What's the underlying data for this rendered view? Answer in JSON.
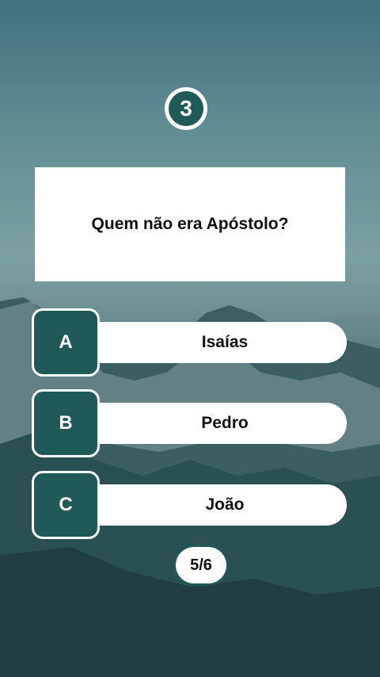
{
  "timer": {
    "value": "3"
  },
  "question": {
    "text": "Quem não era Apóstolo?"
  },
  "answers": [
    {
      "letter": "A",
      "text": "Isaías"
    },
    {
      "letter": "B",
      "text": "Pedro"
    },
    {
      "letter": "C",
      "text": "João"
    }
  ],
  "progress": {
    "text": "5/6"
  },
  "colors": {
    "accent": "#1f5a58",
    "card": "#ffffff",
    "text": "#111111"
  }
}
